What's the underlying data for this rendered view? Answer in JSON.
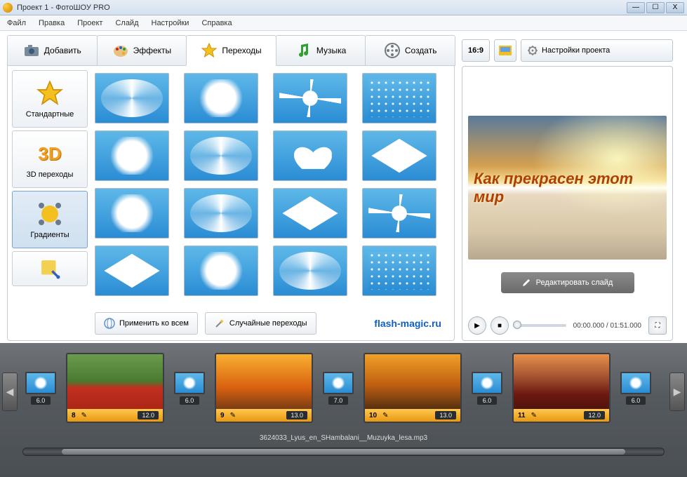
{
  "window": {
    "title": "Проект 1 - ФотоШОУ PRO"
  },
  "menu": [
    "Файл",
    "Правка",
    "Проект",
    "Слайд",
    "Настройки",
    "Справка"
  ],
  "tabs": {
    "add": "Добавить",
    "effects": "Эффекты",
    "transitions": "Переходы",
    "music": "Музыка",
    "create": "Создать"
  },
  "right_top": {
    "aspect": "16:9",
    "settings": "Настройки проекта"
  },
  "categories": {
    "standard": "Стандартные",
    "three_d": "3D переходы",
    "gradients": "Градиенты",
    "three_d_label": "3D"
  },
  "grid_buttons": {
    "apply_all": "Применить ко всем",
    "random": "Случайные переходы"
  },
  "watermark": "flash-magic.ru",
  "preview": {
    "text": "Как  прекрасен этот мир",
    "edit": "Редактировать слайд",
    "time_current": "00:00.000",
    "time_total": "01:51.000"
  },
  "timeline": {
    "slides": [
      {
        "num": "8",
        "dur": "12.0",
        "style": "poppy"
      },
      {
        "num": "9",
        "dur": "13.0",
        "style": "sunset1"
      },
      {
        "num": "10",
        "dur": "13.0",
        "style": "horse"
      },
      {
        "num": "11",
        "dur": "12.0",
        "style": "field"
      }
    ],
    "transitions": [
      {
        "dur": "6.0"
      },
      {
        "dur": "7.0"
      },
      {
        "dur": "6.0"
      },
      {
        "dur": "6.0"
      }
    ],
    "trans_before": {
      "dur": "6.0"
    },
    "audio": "3624033_Lyus_en_SHambalani__Muzuyka_lesa.mp3"
  }
}
